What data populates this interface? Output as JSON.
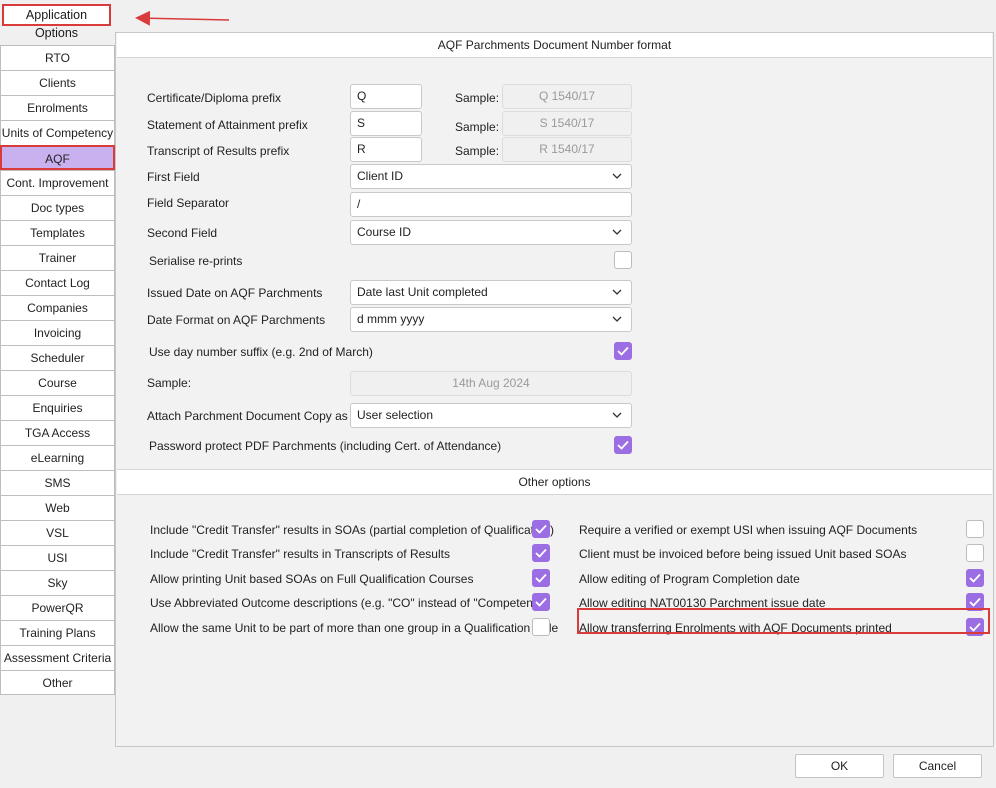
{
  "window": {
    "title": "Application Options"
  },
  "sidebar": {
    "items": [
      {
        "label": "RTO"
      },
      {
        "label": "Clients"
      },
      {
        "label": "Enrolments"
      },
      {
        "label": "Units of Competency"
      },
      {
        "label": "AQF"
      },
      {
        "label": "Cont. Improvement"
      },
      {
        "label": "Doc types"
      },
      {
        "label": "Templates"
      },
      {
        "label": "Trainer"
      },
      {
        "label": "Contact Log"
      },
      {
        "label": "Companies"
      },
      {
        "label": "Invoicing"
      },
      {
        "label": "Scheduler"
      },
      {
        "label": "Course"
      },
      {
        "label": "Enquiries"
      },
      {
        "label": "TGA Access"
      },
      {
        "label": "eLearning"
      },
      {
        "label": "SMS"
      },
      {
        "label": "Web"
      },
      {
        "label": "VSL"
      },
      {
        "label": "USI"
      },
      {
        "label": "Sky"
      },
      {
        "label": "PowerQR"
      },
      {
        "label": "Training Plans"
      },
      {
        "label": "Assessment Criteria"
      },
      {
        "label": "Other"
      }
    ],
    "selected": "AQF"
  },
  "aqf": {
    "header": "AQF Parchments Document Number format",
    "cert_prefix": {
      "label": "Certificate/Diploma prefix",
      "value": "Q",
      "sample_label": "Sample:",
      "sample": "Q 1540/17"
    },
    "soa_prefix": {
      "label": "Statement of Attainment prefix",
      "value": "S",
      "sample_label": "Sample:",
      "sample": "S 1540/17"
    },
    "transcript_prefix": {
      "label": "Transcript of Results prefix",
      "value": "R",
      "sample_label": "Sample:",
      "sample": "R 1540/17"
    },
    "first_field": {
      "label": "First Field",
      "value": "Client ID"
    },
    "field_separator": {
      "label": "Field Separator",
      "value": "/"
    },
    "second_field": {
      "label": "Second Field",
      "value": "Course ID"
    },
    "serialise_reprints": {
      "label": "Serialise re-prints",
      "checked": false
    },
    "issued_date": {
      "label": "Issued Date on AQF Parchments",
      "value": "Date last Unit completed"
    },
    "date_format": {
      "label": "Date Format on AQF Parchments",
      "value": "d mmm yyyy"
    },
    "day_suffix": {
      "label": "Use day number suffix (e.g. 2nd of March)",
      "checked": true
    },
    "sample": {
      "label": "Sample:",
      "value": "14th Aug 2024"
    },
    "attach_copy": {
      "label": "Attach Parchment Document Copy as",
      "value": "User selection"
    },
    "password_protect": {
      "label": "Password protect PDF Parchments (including Cert. of Attendance)",
      "checked": true
    }
  },
  "other": {
    "header": "Other options",
    "left": [
      {
        "label": "Include \"Credit Transfer\" results in SOAs (partial completion of Qualification)",
        "checked": true
      },
      {
        "label": "Include \"Credit Transfer\" results in Transcripts of Results",
        "checked": true
      },
      {
        "label": "Allow printing Unit based SOAs on Full Qualification Courses",
        "checked": true
      },
      {
        "label": "Use Abbreviated Outcome descriptions (e.g. \"CO\" instead of \"Competent\")",
        "checked": true
      },
      {
        "label": "Allow the same Unit to be part of more than one group in a Qualification Rule",
        "checked": false
      }
    ],
    "right": [
      {
        "label": "Require a verified or exempt USI when issuing AQF Documents",
        "checked": false
      },
      {
        "label": "Client must be invoiced before being issued Unit based SOAs",
        "checked": false
      },
      {
        "label": "Allow editing of Program Completion date",
        "checked": true
      },
      {
        "label": "Allow editing NAT00130 Parchment issue date",
        "checked": true
      },
      {
        "label": "Allow transferring Enrolments with AQF Documents printed",
        "checked": true
      }
    ]
  },
  "buttons": {
    "ok": "OK",
    "cancel": "Cancel"
  },
  "colors": {
    "accent": "#9b6ee3",
    "selected_bg": "#c9b1f0",
    "annotation_red": "#d93a3a"
  }
}
